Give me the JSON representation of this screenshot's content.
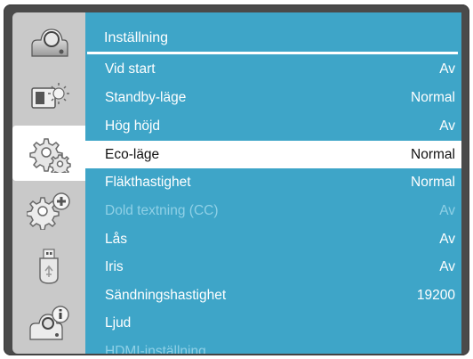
{
  "menu": {
    "title": "Inställning",
    "items": [
      {
        "label": "Vid start",
        "value": "Av",
        "state": "normal"
      },
      {
        "label": "Standby-läge",
        "value": "Normal",
        "state": "normal"
      },
      {
        "label": "Hög höjd",
        "value": "Av",
        "state": "normal"
      },
      {
        "label": "Eco-läge",
        "value": "Normal",
        "state": "selected"
      },
      {
        "label": "Fläkthastighet",
        "value": "Normal",
        "state": "normal"
      },
      {
        "label": "Dold textning (CC)",
        "value": "Av",
        "state": "disabled"
      },
      {
        "label": "Lås",
        "value": "Av",
        "state": "normal"
      },
      {
        "label": "Iris",
        "value": "Av",
        "state": "normal"
      },
      {
        "label": "Sändningshastighet",
        "value": "19200",
        "state": "normal"
      },
      {
        "label": "Ljud",
        "value": "",
        "state": "normal"
      },
      {
        "label": "HDMI-inställning",
        "value": "",
        "state": "disabled"
      }
    ]
  },
  "sidebar": {
    "items": [
      {
        "icon": "projector-icon"
      },
      {
        "icon": "image-adjust-icon"
      },
      {
        "icon": "gear-settings-icon",
        "selected": true
      },
      {
        "icon": "advanced-settings-icon"
      },
      {
        "icon": "usb-icon"
      },
      {
        "icon": "projector-info-icon"
      }
    ]
  },
  "colors": {
    "panel": "#3ea5c8",
    "sidebar": "#c9c9c9",
    "frame": "#4a4a4a",
    "disabled_text": "#8fd0e6"
  }
}
